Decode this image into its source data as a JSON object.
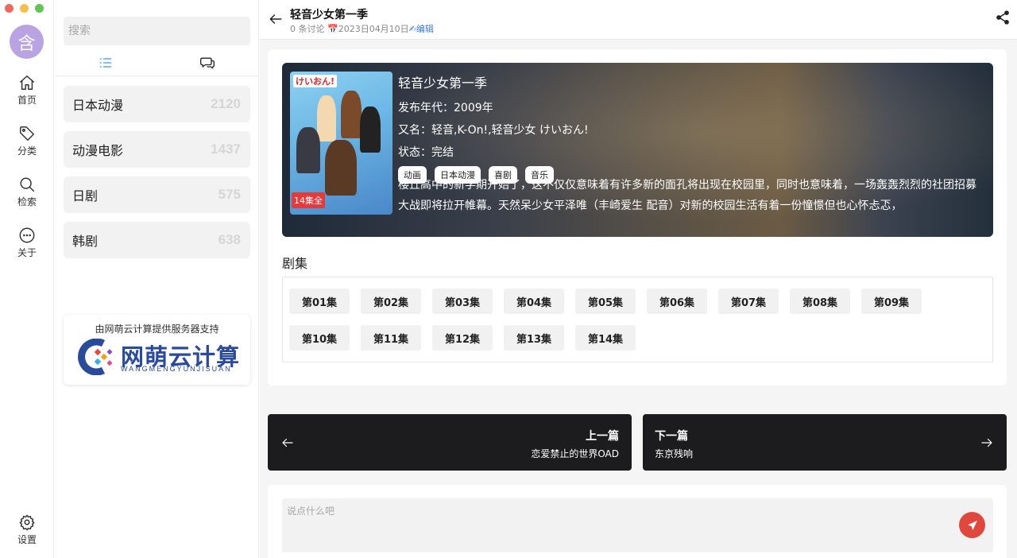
{
  "avatar": {
    "char": "含"
  },
  "rail": {
    "home": "首页",
    "category": "分类",
    "search": "检索",
    "about": "关于",
    "settings": "设置"
  },
  "sidebar": {
    "search_placeholder": "搜索",
    "categories": [
      {
        "name": "日本动漫",
        "count": "2120"
      },
      {
        "name": "动漫电影",
        "count": "1437"
      },
      {
        "name": "日剧",
        "count": "575"
      },
      {
        "name": "韩剧",
        "count": "638"
      }
    ],
    "sponsor": {
      "text": "由网萌云计算提供服务器支持",
      "brand": "网萌云计算",
      "sub": "WANGMENGYUNJISUAN"
    }
  },
  "header": {
    "title": "轻音少女第一季",
    "comments": "0 条讨论",
    "date": "📅2023日04月10日",
    "edit": "✍编辑"
  },
  "detail": {
    "title": "轻音少女第一季",
    "year": "发布年代：2009年",
    "alias": "又名：轻音,K-On!,轻音少女 けいおん!",
    "status": "状态：完结",
    "tags": [
      "动画",
      "日本动漫",
      "喜剧",
      "音乐"
    ],
    "badge": "14集全",
    "poster_title": "けいおん!",
    "description": "樱丘高中的新学期开始了，这不仅仅意味着有许多新的面孔将出现在校园里，同时也意味着，一场轰轰烈烈的社团招募大战即将拉开帷幕。天然呆少女平泽唯（丰崎爱生 配音）对新的校园生活有着一份憧憬但也心怀忐忑，"
  },
  "episodes": {
    "heading": "剧集",
    "items": [
      "第01集",
      "第02集",
      "第03集",
      "第04集",
      "第05集",
      "第06集",
      "第07集",
      "第08集",
      "第09集",
      "第10集",
      "第11集",
      "第12集",
      "第13集",
      "第14集"
    ]
  },
  "nav": {
    "prev_label": "上一篇",
    "prev_title": "恋爱禁止的世界OAD",
    "next_label": "下一篇",
    "next_title": "东京残响"
  },
  "comment": {
    "placeholder": "说点什么吧"
  },
  "colors": {
    "accent": "#3a7bd5",
    "send": "#e0483e",
    "nav_card": "#1c1c1e",
    "avatar": "#b9a3e3"
  }
}
